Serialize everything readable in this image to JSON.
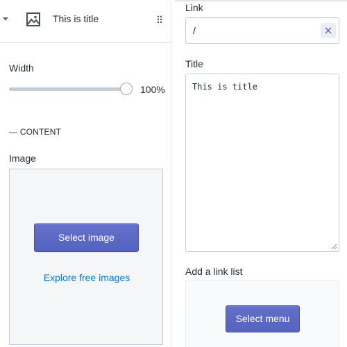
{
  "section": {
    "title": "This is title",
    "icons": {
      "collapse": "caret-down-icon",
      "type": "image-icon",
      "drag": "drag-handle-icon"
    }
  },
  "settings": {
    "width_label": "Width",
    "width_value": "100%",
    "width_fraction": 1.0,
    "content_heading": "— CONTENT",
    "image_label": "Image",
    "select_image_label": "Select image",
    "explore_label": "Explore free images"
  },
  "link": {
    "label": "Link",
    "value": "/",
    "clear_icon": "close-icon"
  },
  "title_field": {
    "label": "Title",
    "value": "This is title"
  },
  "link_list": {
    "label": "Add a link list",
    "select_menu_label": "Select menu"
  },
  "colors": {
    "primary_button": "#5c6ac4",
    "link": "#007ace",
    "border": "#c4cdd5"
  }
}
